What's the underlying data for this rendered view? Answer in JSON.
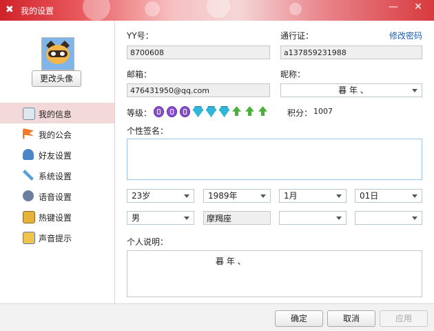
{
  "window": {
    "title": "我的设置",
    "minimize_label": "—",
    "close_label": "✕"
  },
  "sidebar": {
    "change_avatar_label": "更改头像",
    "items": [
      {
        "label": "我的信息",
        "icon": "id-card-icon",
        "active": true
      },
      {
        "label": "我的公会",
        "icon": "flag-icon",
        "active": false
      },
      {
        "label": "好友设置",
        "icon": "user-icon",
        "active": false
      },
      {
        "label": "系统设置",
        "icon": "wrench-icon",
        "active": false
      },
      {
        "label": "语音设置",
        "icon": "speaker-icon",
        "active": false
      },
      {
        "label": "热键设置",
        "icon": "keyboard-icon",
        "active": false
      },
      {
        "label": "声音提示",
        "icon": "sound-icon",
        "active": false
      }
    ]
  },
  "profile": {
    "yy_label": "YY号：",
    "yy_value": "8700608",
    "passport_label": "通行证：",
    "passport_value": "a137859231988",
    "change_password_label": "修改密码",
    "email_label": "邮箱：",
    "email_value": "476431950@qq.com",
    "nickname_label": "昵称：",
    "nickname_value": "暮    年 、",
    "level_label": "等级：",
    "points_label": "积分：",
    "points_value": "1007",
    "signature_label": "个性签名：",
    "signature_value": "",
    "age_value": "23岁",
    "birth_year_value": "1989年",
    "birth_month_value": "1月",
    "birth_day_value": "01日",
    "gender_value": "男",
    "zodiac_value": "摩羯座",
    "province_value": "",
    "city_value": "",
    "description_label": "个人说明：",
    "description_value": "暮    年 、"
  },
  "footer": {
    "ok_label": "确定",
    "cancel_label": "取消",
    "apply_label": "应用"
  },
  "colors": {
    "title_red": "#d0232a",
    "active_nav": "#f4d9da",
    "link": "#1a5fb4",
    "signature_border": "#9cc4e4"
  }
}
